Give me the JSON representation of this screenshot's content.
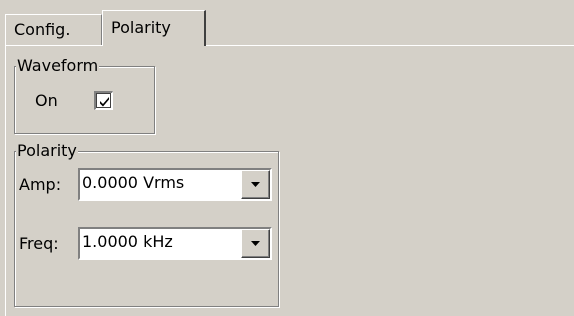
{
  "tabs": [
    {
      "label": "Config.",
      "selected": false
    },
    {
      "label": "Polarity",
      "selected": true
    }
  ],
  "waveform_group": {
    "title": "Waveform",
    "on_label": "On",
    "on_checked": true
  },
  "polarity_group": {
    "title": "Polarity",
    "amp": {
      "label": "Amp:",
      "value": "0.0000 Vrms"
    },
    "freq": {
      "label": "Freq:",
      "value": "1.0000 kHz"
    }
  },
  "icons": {
    "check": "check-mark-icon",
    "dropdown": "chevron-down-icon"
  },
  "colors": {
    "panel": "#d4d0c8",
    "field": "#ffffff",
    "shadow": "#808080"
  }
}
